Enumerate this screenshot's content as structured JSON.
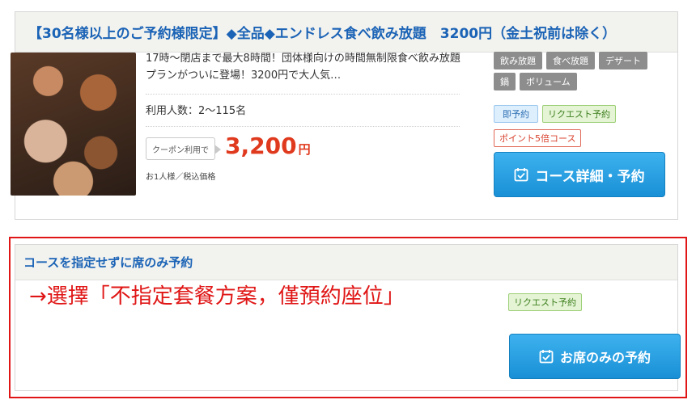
{
  "course": {
    "title": "【30名様以上のご予約様限定】◆全品◆エンドレス食べ飲み放題　3200円（金土祝前は除く）",
    "description": "17時～閉店まで最大8時間！団体様向けの時間無制限食べ飲み放題プランがついに登場！3200円で大人気…",
    "people": "利用人数：2～115名",
    "coupon_label": "クーポン利用で",
    "price": "3,200",
    "price_unit": "円",
    "tax_note": "お1人様／税込価格",
    "tags_gray": [
      "飲み放題",
      "食べ放題",
      "デザート",
      "鍋",
      "ボリューム"
    ],
    "tag_instant": "即予約",
    "tag_request": "リクエスト予約",
    "tag_points": "ポイント5倍コース",
    "button_label": "コース詳細・予約"
  },
  "seat_only": {
    "title": "コースを指定せずに席のみ予約",
    "tag_request": "リクエスト予約",
    "button_label": "お席のみの予約"
  },
  "annotation": "→選擇「不指定套餐方案，僅預約座位」",
  "colors": {
    "title_blue": "#1b63b6",
    "price_red": "#e03a1e",
    "button_blue": "#1990d6",
    "highlight_red": "#e01616"
  },
  "icons": {
    "course_photo": "food-photo-image",
    "button_icon": "calendar-check-icon"
  }
}
